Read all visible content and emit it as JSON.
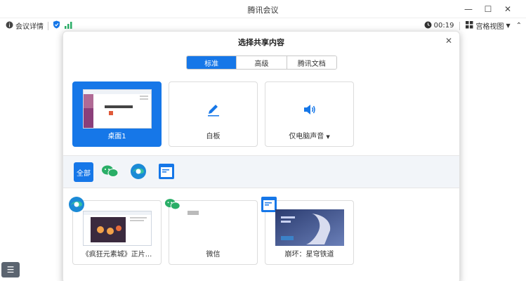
{
  "window": {
    "title": "腾讯会议"
  },
  "toolbar": {
    "meeting_details": "会议详情",
    "timer": "00:19",
    "view_mode": "宫格视图"
  },
  "dialog": {
    "title": "选择共享内容",
    "tabs": [
      "标准",
      "高级",
      "腾讯文档"
    ],
    "share_options": [
      {
        "label": "桌面1"
      },
      {
        "label": "白板"
      },
      {
        "label": "仅电脑声音"
      }
    ],
    "filter_all": "全部",
    "apps": [
      {
        "label": "《疯狂元素城》正片..."
      },
      {
        "label": "微信"
      },
      {
        "label": "崩坏：星穹铁道"
      }
    ]
  },
  "colors": {
    "accent": "#1677e8",
    "wechat_green": "#2aae67",
    "filter_bar_bg": "#f2f5f9"
  }
}
